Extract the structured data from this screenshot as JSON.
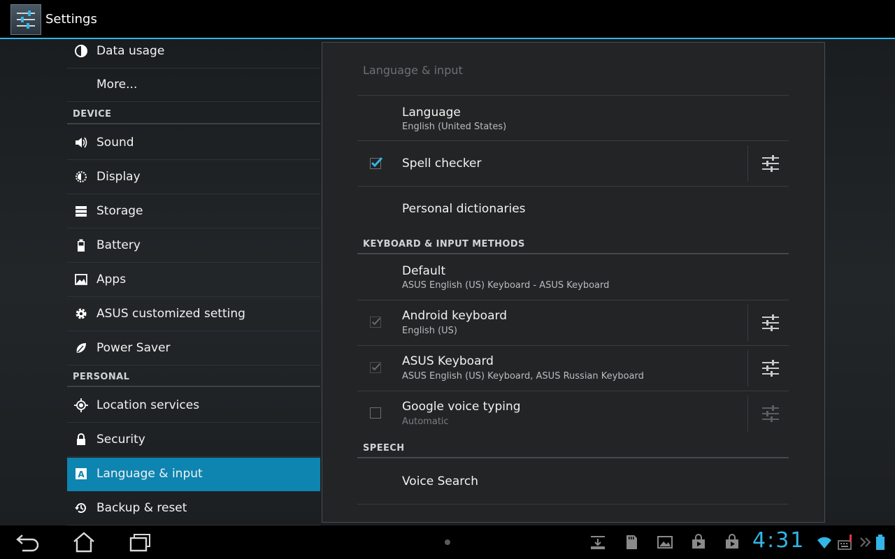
{
  "app": {
    "title": "Settings"
  },
  "sidebar": {
    "items": [
      {
        "label": "Data usage",
        "icon": "data-usage-icon"
      },
      {
        "label": "More...",
        "icon": ""
      },
      {
        "header": "DEVICE"
      },
      {
        "label": "Sound",
        "icon": "speaker-icon"
      },
      {
        "label": "Display",
        "icon": "brightness-icon"
      },
      {
        "label": "Storage",
        "icon": "storage-icon"
      },
      {
        "label": "Battery",
        "icon": "battery-icon"
      },
      {
        "label": "Apps",
        "icon": "apps-icon"
      },
      {
        "label": "ASUS customized setting",
        "icon": "gear-icon"
      },
      {
        "label": "Power Saver",
        "icon": "leaf-icon"
      },
      {
        "header": "PERSONAL"
      },
      {
        "label": "Location services",
        "icon": "location-icon"
      },
      {
        "label": "Security",
        "icon": "lock-icon"
      },
      {
        "label": "Language & input",
        "icon": "language-icon",
        "selected": true
      },
      {
        "label": "Backup & reset",
        "icon": "backup-icon"
      }
    ]
  },
  "panel": {
    "title": "Language & input",
    "language": {
      "title": "Language",
      "summary": "English (United States)"
    },
    "spell_checker": {
      "title": "Spell checker",
      "checked": true
    },
    "personal_dictionaries": {
      "title": "Personal dictionaries"
    },
    "keyboard_header": "KEYBOARD & INPUT METHODS",
    "default": {
      "title": "Default",
      "summary": "ASUS English (US) Keyboard - ASUS Keyboard"
    },
    "android_keyboard": {
      "title": "Android keyboard",
      "summary": "English (US)",
      "checked": true,
      "enabled": false
    },
    "asus_keyboard": {
      "title": "ASUS Keyboard",
      "summary": "ASUS English (US) Keyboard, ASUS Russian Keyboard",
      "checked": true,
      "enabled": false
    },
    "google_voice": {
      "title": "Google voice typing",
      "summary": "Automatic",
      "checked": false
    },
    "speech_header": "SPEECH",
    "voice_search": {
      "title": "Voice Search"
    }
  },
  "system_bar": {
    "clock": "4:31",
    "accent": "#33b5e5",
    "selected_color": "#0e84b0"
  }
}
